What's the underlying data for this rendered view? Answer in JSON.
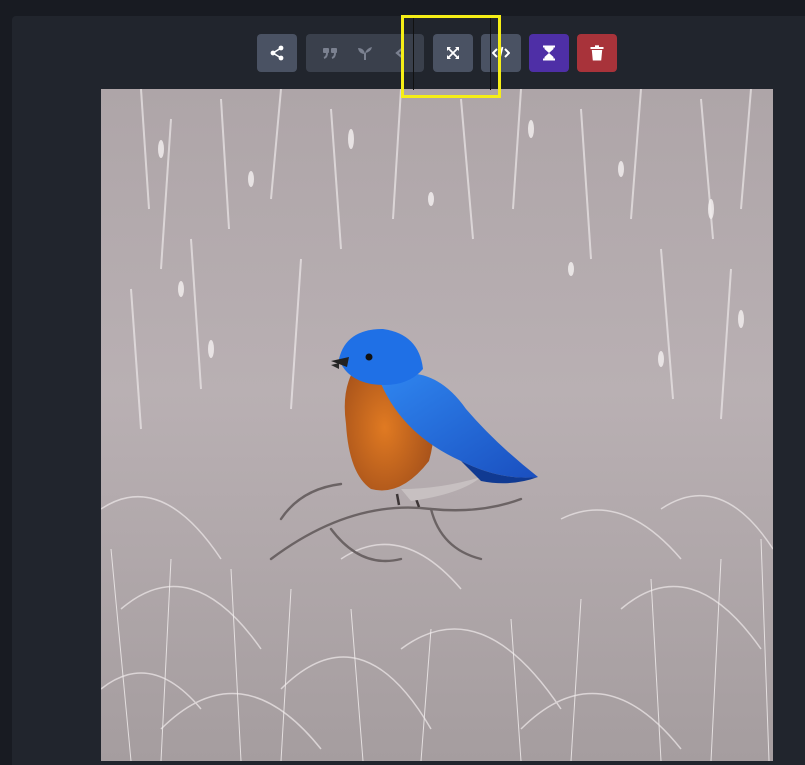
{
  "toolbar": {
    "buttons": [
      {
        "name": "share",
        "icon": "share-icon",
        "color": "#4a5263"
      },
      {
        "name": "quote",
        "icon": "quote-icon",
        "disabled": true
      },
      {
        "name": "seedling",
        "icon": "seedling-icon",
        "disabled": true
      },
      {
        "name": "less-than",
        "icon": "chevron-left-icon",
        "disabled": true
      },
      {
        "name": "expand",
        "icon": "expand-icon",
        "color": "#4a5263"
      },
      {
        "name": "code",
        "icon": "code-icon",
        "color": "#4a5263"
      },
      {
        "name": "hourglass",
        "icon": "hourglass-icon",
        "color": "#4e2fa6"
      },
      {
        "name": "delete",
        "icon": "trash-icon",
        "color": "#a8333a"
      }
    ]
  },
  "highlight": {
    "color": "#f5ee16",
    "target": "expand-button"
  },
  "image": {
    "subject": "bluebird-on-branch",
    "palette": {
      "background": "#b7aeb0",
      "bird_blue": "#1f6fe0",
      "bird_orange": "#d06a1e"
    }
  }
}
